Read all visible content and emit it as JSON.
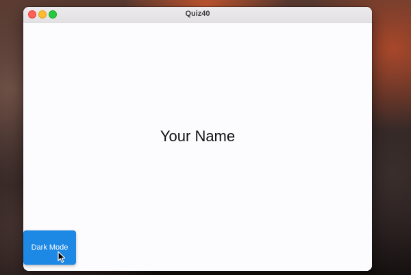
{
  "window": {
    "title": "Quiz40"
  },
  "main": {
    "name_text": "Your Name"
  },
  "dark_mode_button": {
    "label": "Dark Mode",
    "color": "#1e88e5"
  },
  "icons": {
    "close": "close-window-icon",
    "minimize": "minimize-window-icon",
    "maximize": "maximize-window-icon",
    "cursor": "mouse-pointer-icon"
  }
}
